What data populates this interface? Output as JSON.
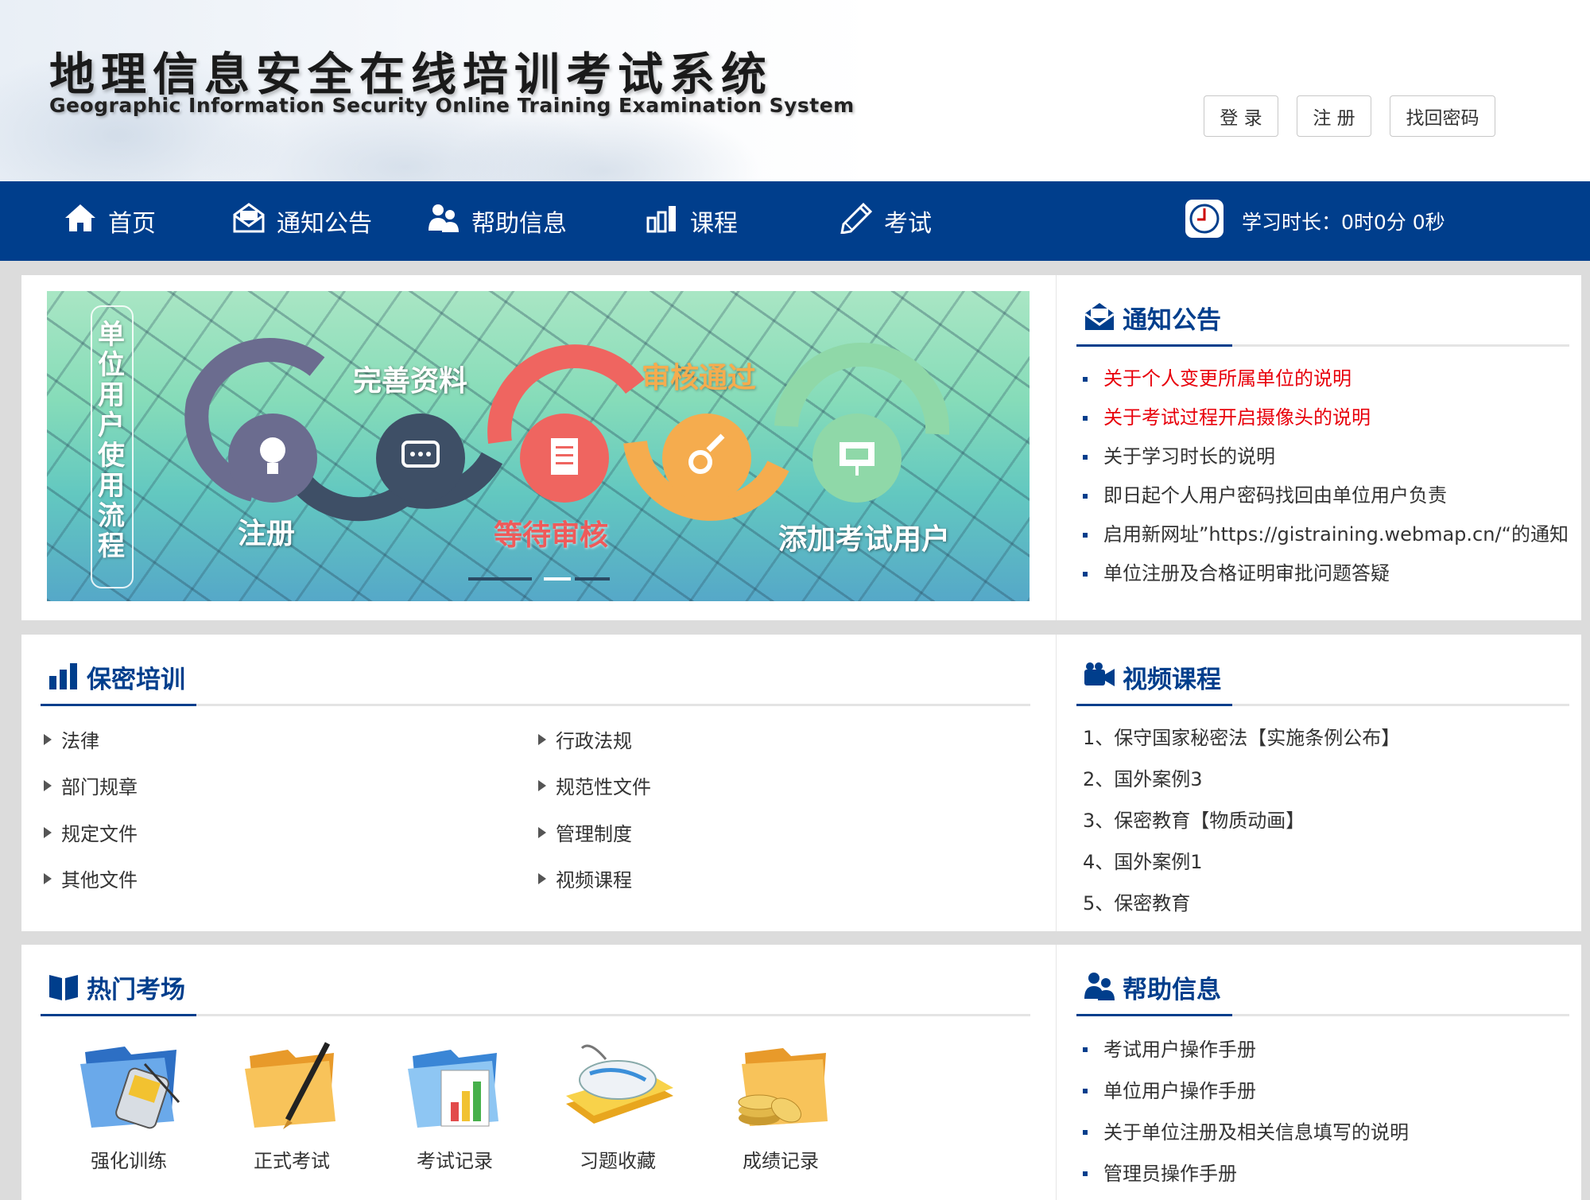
{
  "header": {
    "title": "地理信息安全在线培训考试系统",
    "subtitle": "Geographic Information Security Online Training Examination System",
    "login": "登 录",
    "register": "注 册",
    "recover": "找回密码"
  },
  "nav": {
    "items": [
      "首页",
      "通知公告",
      "帮助信息",
      "课程",
      "考试"
    ],
    "timer_label": "学习时长：0时0分 0秒"
  },
  "banner": {
    "vertical_title": "单位用户使用流程",
    "steps": [
      "注册",
      "完善资料",
      "等待审核",
      "审核通过",
      "添加考试用户"
    ],
    "slide_count": 3,
    "active_slide": 2
  },
  "notices": {
    "title": "通知公告",
    "items": [
      {
        "text": "关于个人变更所属单位的说明",
        "highlight": true
      },
      {
        "text": "关于考试过程开启摄像头的说明",
        "highlight": true
      },
      {
        "text": "关于学习时长的说明",
        "highlight": false
      },
      {
        "text": "即日起个人用户密码找回由单位用户负责",
        "highlight": false
      },
      {
        "text": "启用新网址”https://gistraining.webmap.cn/“的通知",
        "highlight": false
      },
      {
        "text": "单位注册及合格证明审批问题答疑",
        "highlight": false
      }
    ]
  },
  "training": {
    "title": "保密培训",
    "items": [
      "法律",
      "行政法规",
      "部门规章",
      "规范性文件",
      "规定文件",
      "管理制度",
      "其他文件",
      "视频课程"
    ]
  },
  "videos": {
    "title": "视频课程",
    "items": [
      "1、保守国家秘密法【实施条例公布】",
      "2、国外案例3",
      "3、保密教育【物质动画】",
      "4、国外案例1",
      "5、保密教育"
    ]
  },
  "exams": {
    "title": "热门考场",
    "items": [
      "强化训练",
      "正式考试",
      "考试记录",
      "习题收藏",
      "成绩记录"
    ]
  },
  "help": {
    "title": "帮助信息",
    "items": [
      "考试用户操作手册",
      "单位用户操作手册",
      "关于单位注册及相关信息填写的说明",
      "管理员操作手册"
    ]
  },
  "colors": {
    "primary": "#003e8c",
    "highlight": "#e8000b"
  }
}
